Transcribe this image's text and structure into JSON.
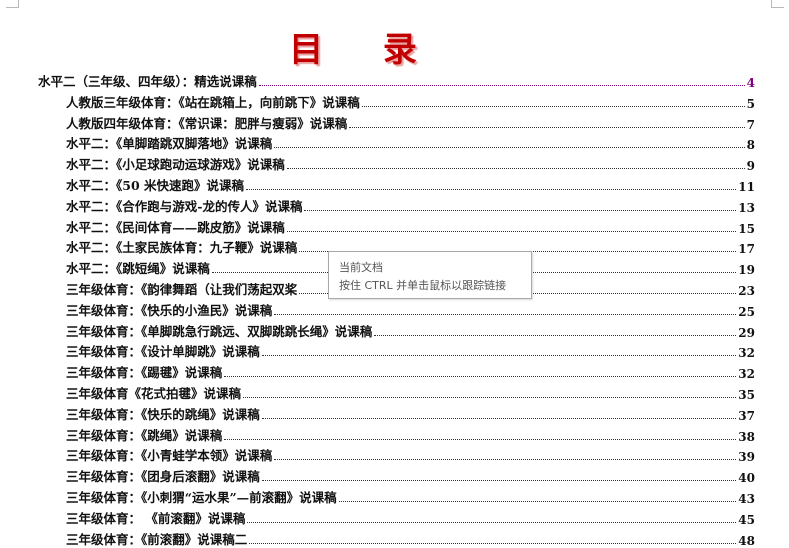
{
  "title": "目 录",
  "entries": [
    {
      "text": "水平二（三年级、四年级）：精选说课稿",
      "page": "4"
    },
    {
      "text": "人教版三年级体育：《站在跳箱上，向前跳下》说课稿",
      "page": "5"
    },
    {
      "text": "人教版四年级体育：《常识课：肥胖与瘦弱》说课稿",
      "page": "7"
    },
    {
      "text": "水平二：《单脚踏跳双脚落地》说课稿",
      "page": "8"
    },
    {
      "text": "水平二：《小足球跑动运球游戏》说课稿",
      "page": "9"
    },
    {
      "text": "水平二：《50 米快速跑》说课稿",
      "page": "11"
    },
    {
      "text": "水平二：《合作跑与游戏-龙的传人》说课稿",
      "page": "13"
    },
    {
      "text": "水平二：《民间体育——跳皮筋》说课稿",
      "page": "15"
    },
    {
      "text": "水平二：《土家民族体育：九子鞭》说课稿",
      "page": "17"
    },
    {
      "text": "水平二：《跳短绳》说课稿",
      "page": "19"
    },
    {
      "text": "三年级体育：《韵律舞蹈（让我们荡起双桨",
      "page": "23"
    },
    {
      "text": "三年级体育：《快乐的小渔民》说课稿",
      "page": "25"
    },
    {
      "text": "三年级体育：《单脚跳急行跳远、双脚跳跳长绳》说课稿",
      "page": "29"
    },
    {
      "text": "三年级体育：《设计单脚跳》说课稿",
      "page": "32"
    },
    {
      "text": "三年级体育：《踢毽》说课稿",
      "page": "32"
    },
    {
      "text": "三年级体育《花式拍毽》说课稿",
      "page": "35"
    },
    {
      "text": "三年级体育：《快乐的跳绳》说课稿",
      "page": "37"
    },
    {
      "text": "三年级体育：《跳绳》说课稿",
      "page": "38"
    },
    {
      "text": "三年级体育：《小青蛙学本领》说课稿",
      "page": "39"
    },
    {
      "text": "三年级体育：《团身后滚翻》说课稿",
      "page": "40"
    },
    {
      "text": "三年级体育：《小刺猬“运水果”—前滚翻》说课稿",
      "page": "43"
    },
    {
      "text": "三年级体育：  《前滚翻》说课稿",
      "page": "45"
    },
    {
      "text": "三年级体育：《前滚翻》说课稿二",
      "page": "48"
    }
  ],
  "tooltip": {
    "line1": "当前文档",
    "line2": "按住 CTRL 并单击鼠标以跟踪链接"
  }
}
